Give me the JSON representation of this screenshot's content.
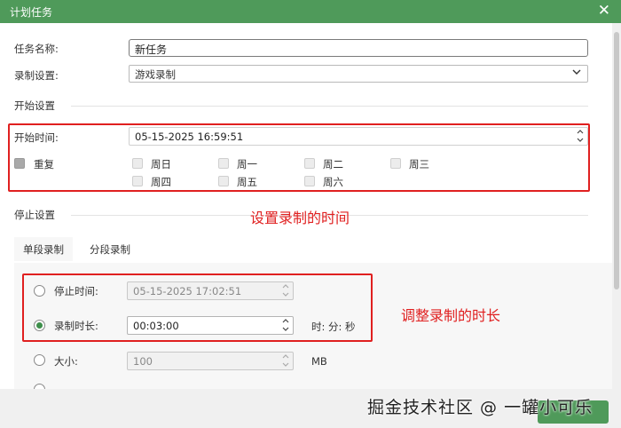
{
  "window": {
    "title": "计划任务"
  },
  "form": {
    "task_name_label": "任务名称:",
    "task_name_value": "新任务",
    "record_setting_label": "录制设置:",
    "record_setting_value": "游戏录制"
  },
  "start": {
    "section_title": "开始设置",
    "start_time_label": "开始时间:",
    "start_time_value": "05-15-2025 16:59:51",
    "repeat_label": "重复",
    "days": [
      "周日",
      "周一",
      "周二",
      "周三",
      "周四",
      "周五",
      "周六"
    ]
  },
  "stop": {
    "section_title": "停止设置",
    "tabs": [
      "单段录制",
      "分段录制"
    ],
    "stop_time_label": "停止时间:",
    "stop_time_value": "05-15-2025 17:02:51",
    "duration_label": "录制时长:",
    "duration_value": "00:03:00",
    "duration_unit": "时: 分: 秒",
    "size_label": "大小:",
    "size_value": "100",
    "size_unit": "MB",
    "selected_option": "录制时长"
  },
  "annotations": {
    "start_note": "设置录制的时间",
    "duration_note": "调整录制的时长"
  },
  "watermark": "掘金技术社区 @ 一罐小可乐",
  "colors": {
    "accent": "#4f9a5a",
    "annotation": "#e02020"
  },
  "icons": {
    "close": "close-icon",
    "dropdown": "chevron-down-icon",
    "spinner": "spinner-arrows-icon"
  }
}
